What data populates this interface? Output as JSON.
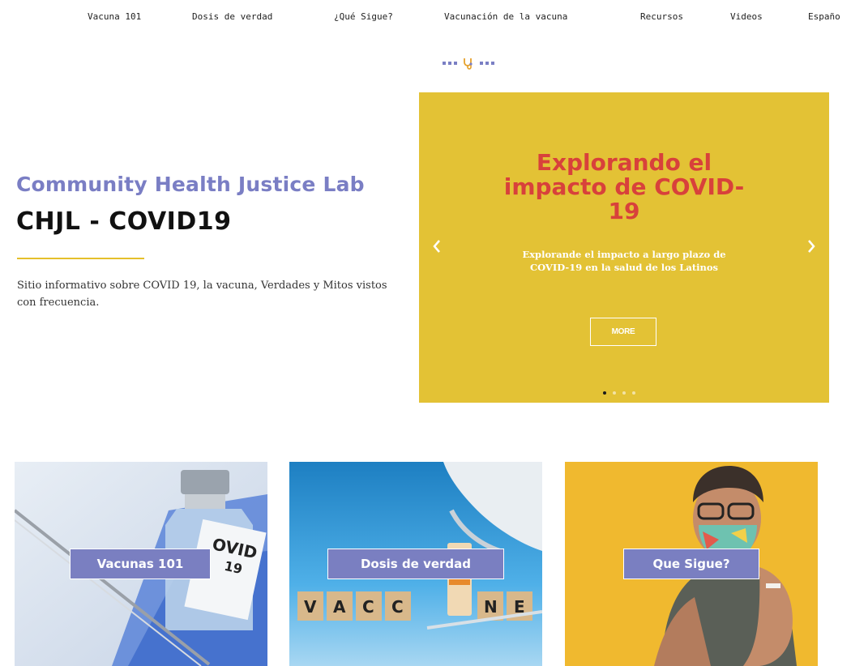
{
  "nav": {
    "items": [
      "Vacuna 101",
      "Dosis de verdad",
      "¿Qué Sigue?",
      "Vacunación de la vacuna",
      "Recursos",
      "Videos",
      "Españo"
    ]
  },
  "hero": {
    "lab_title": "Community Health Justice Lab",
    "main_title": "CHJL - COVID19",
    "description": "Sitio informativo sobre COVID 19, la vacuna, Verdades y Mitos vistos con frecuencia."
  },
  "carousel": {
    "slide_title": "Explorando el impacto de COVID-19",
    "slide_text": "Explorande el impacto a largo plazo de COVID-19 en la salud de los Latinos",
    "button_label": "MORE",
    "slide_count": 4,
    "active_slide": 1
  },
  "cards": [
    {
      "label": "Vacunas 101"
    },
    {
      "label": "Dosis de verdad"
    },
    {
      "label": "Que Sigue?"
    }
  ],
  "colors": {
    "accent_purple": "#7a7ec4",
    "carousel_yellow": "#e3c235",
    "slide_title_red": "#d8413b",
    "rule_gold": "#e5c02b"
  },
  "icons": {
    "divider": "stethoscope-icon",
    "prev": "chevron-left-icon",
    "next": "chevron-right-icon"
  }
}
